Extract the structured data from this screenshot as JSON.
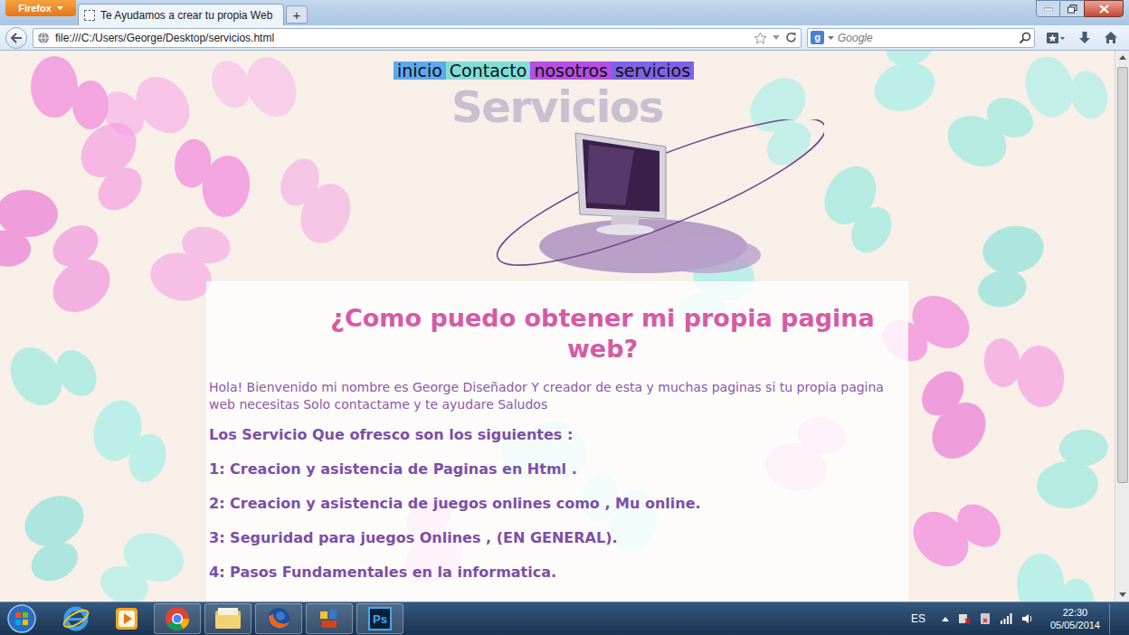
{
  "browser": {
    "menu_button": "Firefox",
    "tabs": [
      {
        "label": "Te Ayudamos a crear tu propia Web",
        "selected": true
      }
    ],
    "new_tab": "+",
    "address": "file:///C:/Users/George/Desktop/servicios.html",
    "search": {
      "engine_badge": "g",
      "placeholder": "Google"
    }
  },
  "page": {
    "nav": [
      {
        "label": "inicio",
        "color": "#5fa8ee"
      },
      {
        "label": "Contacto",
        "color": "#7fded6"
      },
      {
        "label": "nosotros",
        "color": "#b54ee3"
      },
      {
        "label": "servicios",
        "color": "#7d63e6"
      }
    ],
    "title": "Servicios",
    "heading": "¿Como puedo obtener mi propia pagina web?",
    "intro": "Hola! Bienvenido mi nombre es George Diseñador Y creador de esta y muchas paginas si tu propia pagina web necesitas Solo contactame y te ayudare Saludos",
    "services_title": "Los Servicio Que ofresco son los siguientes :",
    "services": [
      "1: Creacion y asistencia de Paginas en Html .",
      "2: Creacion y asistencia de juegos onlines como , Mu online.",
      "3: Seguridad para juegos Onlines , (EN GENERAL).",
      "4: Pasos Fundamentales en la informatica."
    ]
  },
  "taskbar": {
    "apps": [
      {
        "kind": "ie",
        "running": false
      },
      {
        "kind": "media",
        "running": false
      },
      {
        "kind": "chrome",
        "running": true
      },
      {
        "kind": "explorer",
        "running": true
      },
      {
        "kind": "firefox",
        "running": true
      },
      {
        "kind": "tool",
        "running": true
      },
      {
        "kind": "photoshop",
        "label": "Ps",
        "running": true
      }
    ],
    "language": "ES",
    "time": "22:30",
    "date": "05/05/2014"
  }
}
